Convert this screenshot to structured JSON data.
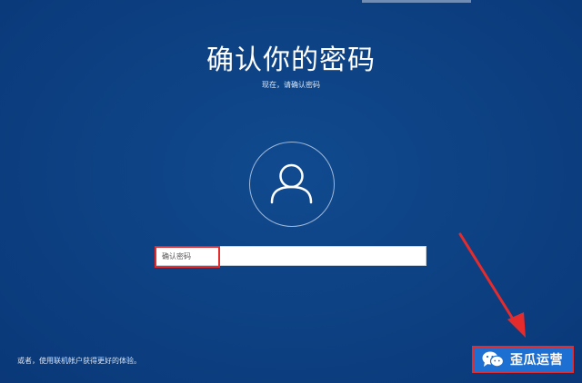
{
  "page": {
    "title": "确认你的密码",
    "subtitle": "现在，请确认密码"
  },
  "password": {
    "placeholder": "确认密码",
    "value": ""
  },
  "footer": {
    "link_text": "或者，使用联机帐户获得更好的体验。"
  },
  "watermark": {
    "label": "歪瓜运营",
    "icon": "wechat-icon"
  },
  "annotations": {
    "highlight_color": "#e52b2b",
    "arrow_color": "#e52b2b"
  },
  "colors": {
    "background": "#0c3f7c",
    "badge": "#1d6fd1"
  }
}
